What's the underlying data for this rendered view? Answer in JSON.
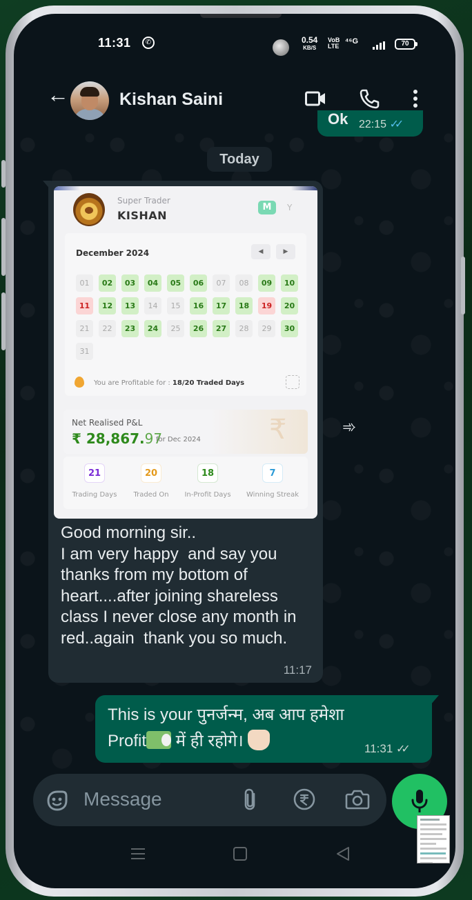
{
  "status_bar": {
    "time": "11:31",
    "net_speed": "0.54",
    "net_unit": "KB/S",
    "volte": "VoB LTE",
    "net_type": "⁴⁶G",
    "battery": "70"
  },
  "header": {
    "contact_name": "Kishan Saini"
  },
  "messages": {
    "ok": {
      "text": "Ok",
      "time": "22:15"
    },
    "date_divider": "Today",
    "image_message": {
      "card": {
        "subtitle": "Super Trader",
        "name": "KISHAN",
        "toggle_m": "M",
        "toggle_y": "Y",
        "month": "December 2024",
        "days": [
          {
            "d": "01",
            "s": "none"
          },
          {
            "d": "02",
            "s": "profit"
          },
          {
            "d": "03",
            "s": "profit"
          },
          {
            "d": "04",
            "s": "profit"
          },
          {
            "d": "05",
            "s": "profit"
          },
          {
            "d": "06",
            "s": "profit"
          },
          {
            "d": "07",
            "s": "none"
          },
          {
            "d": "08",
            "s": "none"
          },
          {
            "d": "09",
            "s": "profit"
          },
          {
            "d": "10",
            "s": "profit"
          },
          {
            "d": "11",
            "s": "loss"
          },
          {
            "d": "12",
            "s": "profit"
          },
          {
            "d": "13",
            "s": "profit"
          },
          {
            "d": "14",
            "s": "none"
          },
          {
            "d": "15",
            "s": "none"
          },
          {
            "d": "16",
            "s": "profit"
          },
          {
            "d": "17",
            "s": "profit"
          },
          {
            "d": "18",
            "s": "profit"
          },
          {
            "d": "19",
            "s": "loss"
          },
          {
            "d": "20",
            "s": "profit"
          },
          {
            "d": "21",
            "s": "none"
          },
          {
            "d": "22",
            "s": "none"
          },
          {
            "d": "23",
            "s": "profit"
          },
          {
            "d": "24",
            "s": "profit"
          },
          {
            "d": "25",
            "s": "none"
          },
          {
            "d": "26",
            "s": "profit"
          },
          {
            "d": "27",
            "s": "profit"
          },
          {
            "d": "28",
            "s": "none"
          },
          {
            "d": "29",
            "s": "none"
          },
          {
            "d": "30",
            "s": "profit"
          },
          {
            "d": "31",
            "s": "none"
          }
        ],
        "profitable_label": "You are Profitable for :",
        "profitable_value": "18/20 Traded Days",
        "pnl_label": "Net Realised P&L",
        "pnl_int": "₹ 28,867.",
        "pnl_dec": "97",
        "pnl_period": "for Dec 2024",
        "stats": [
          {
            "value": "21",
            "label": "Trading Days",
            "color": "#7a2bd6"
          },
          {
            "value": "20",
            "label": "Traded On",
            "color": "#e49a1c"
          },
          {
            "value": "18",
            "label": "In-Profit Days",
            "color": "#2e8a1c"
          },
          {
            "value": "7",
            "label": "Winning Streak",
            "color": "#2b9ad6"
          }
        ]
      },
      "text": "Good morning sir..\nI am very happy  and say you thanks from my bottom of heart....after joining shareless class I never close any month in red..again  thank you so much.",
      "time": "11:17"
    },
    "reply": {
      "line1": "This is your पुनर्जन्म, अब आप हमेशा",
      "line2_a": "Profit",
      "line2_b": " में ही रहोगे। ",
      "time": "11:31"
    }
  },
  "input": {
    "placeholder": "Message"
  },
  "colors": {
    "outgoing_bubble": "#005c4b",
    "incoming_bubble": "#202c33",
    "accent_green": "#21c063",
    "read_ticks": "#53bdeb"
  },
  "icons": [
    "whatsapp-status-icon",
    "back-arrow-icon",
    "video-call-icon",
    "voice-call-icon",
    "more-menu-icon",
    "forward-icon",
    "sticker-icon",
    "attach-icon",
    "rupee-payment-icon",
    "camera-icon",
    "mic-icon"
  ]
}
